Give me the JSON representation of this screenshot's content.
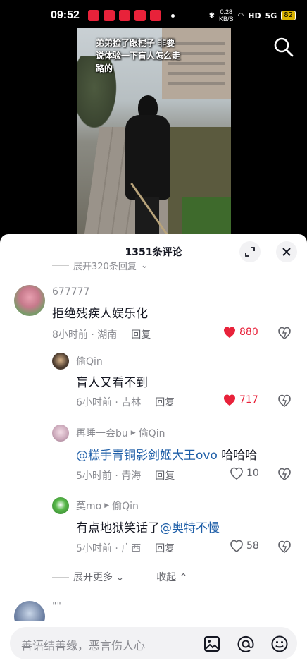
{
  "status_bar": {
    "time": "09:52",
    "network_speed_value": "0.28",
    "network_speed_unit": "KB/S",
    "signal": "HD",
    "network": "5G",
    "battery": "82"
  },
  "video": {
    "caption": "弟弟捡了跟棍子 非要说体验一下盲人怎么走路的"
  },
  "sheet": {
    "title": "1351条评论",
    "cut_line_text": "展开320条回复"
  },
  "comments": [
    {
      "user": "677777",
      "text": "拒绝残疾人娱乐化",
      "time": "8小时前",
      "location": "湖南",
      "reply_label": "回复",
      "likes": "880",
      "liked": true
    },
    {
      "user": "偷Qin",
      "text": "盲人又看不到",
      "time": "6小时前",
      "location": "吉林",
      "reply_label": "回复",
      "likes": "717",
      "liked": true
    },
    {
      "user": "再睡一会bu",
      "reply_to": "偷Qin",
      "mention": "@糕手青铜影剑姬大王ovo",
      "text_after": " 哈哈哈",
      "time": "5小时前",
      "location": "青海",
      "reply_label": "回复",
      "likes": "10",
      "liked": false
    },
    {
      "user": "莫mo",
      "reply_to": "偷Qin",
      "text_before": "有点地狱笑话了",
      "mention": "@奥特不慢",
      "time": "5小时前",
      "location": "广西",
      "reply_label": "回复",
      "likes": "58",
      "liked": false
    }
  ],
  "more_replies": {
    "expand_label": "展开更多",
    "collapse_label": "收起"
  },
  "partial_comment": {
    "user": "\"\""
  },
  "input": {
    "placeholder": "善语结善缘，恶言伤人心"
  },
  "colors": {
    "like_red": "#e8223a",
    "mention_blue": "#1f5fa8",
    "meta_grey": "#8a8b91"
  },
  "icons": [
    "search-icon",
    "expand-icon",
    "close-icon",
    "heart-icon",
    "dislike-icon",
    "image-icon",
    "at-icon",
    "emoji-icon",
    "chevron-down-icon",
    "chevron-up-icon"
  ]
}
